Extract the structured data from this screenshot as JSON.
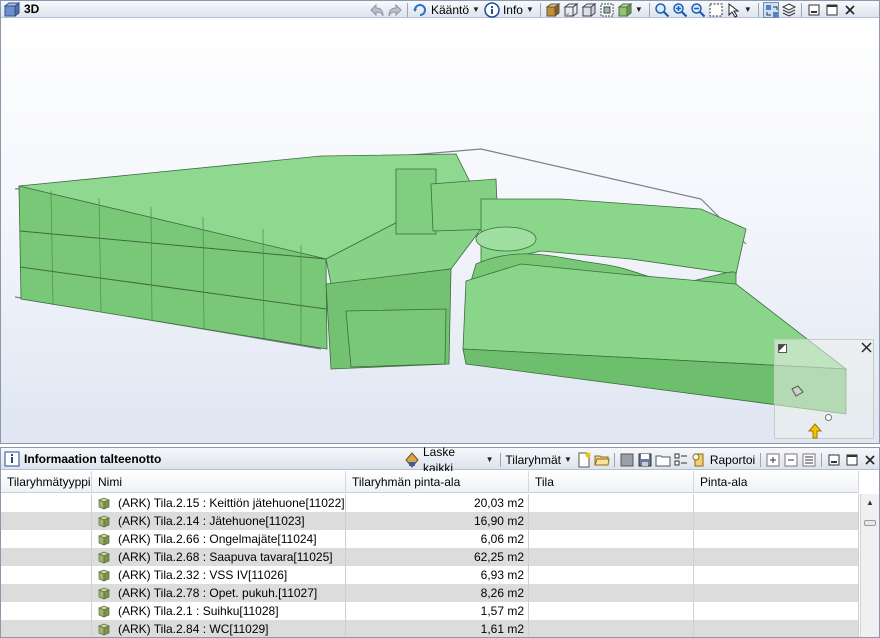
{
  "window3d": {
    "title": "3D",
    "toolbar": {
      "rotate_label": "Kääntö",
      "info_label": "Info"
    }
  },
  "panel": {
    "title": "Informaation talteenotto",
    "toolbar": {
      "calc_all_label": "Laske kaikki",
      "groups_label": "Tilaryhmät",
      "report_label": "Raportoi"
    }
  },
  "table": {
    "columns": [
      "Tilaryhmätyyppi",
      "Nimi",
      "Tilaryhmän pinta-ala",
      "Tila",
      "Pinta-ala"
    ],
    "rows": [
      {
        "type": "",
        "name": "(ARK) Tila.2.15 : Keittiön jätehuone[11022]",
        "area": "20,03 m2",
        "space": "",
        "space_area": ""
      },
      {
        "type": "",
        "name": "(ARK) Tila.2.14 : Jätehuone[11023]",
        "area": "16,90 m2",
        "space": "",
        "space_area": ""
      },
      {
        "type": "",
        "name": "(ARK) Tila.2.66 : Ongelmajäte[11024]",
        "area": "6,06 m2",
        "space": "",
        "space_area": ""
      },
      {
        "type": "",
        "name": "(ARK) Tila.2.68 : Saapuva tavara[11025]",
        "area": "62,25 m2",
        "space": "",
        "space_area": ""
      },
      {
        "type": "",
        "name": "(ARK) Tila.2.32 : VSS IV[11026]",
        "area": "6,93 m2",
        "space": "",
        "space_area": ""
      },
      {
        "type": "",
        "name": "(ARK) Tila.2.78 : Opet. pukuh.[11027]",
        "area": "8,26 m2",
        "space": "",
        "space_area": ""
      },
      {
        "type": "",
        "name": "(ARK) Tila.2.1 : Suihku[11028]",
        "area": "1,57 m2",
        "space": "",
        "space_area": ""
      },
      {
        "type": "",
        "name": "(ARK) Tila.2.84 : WC[11029]",
        "area": "1,61 m2",
        "space": "",
        "space_area": ""
      }
    ]
  },
  "colors": {
    "model_green": "#7fcc7f",
    "row_stripe": "#dcdcdc",
    "titlebar": "#dde4ee"
  }
}
